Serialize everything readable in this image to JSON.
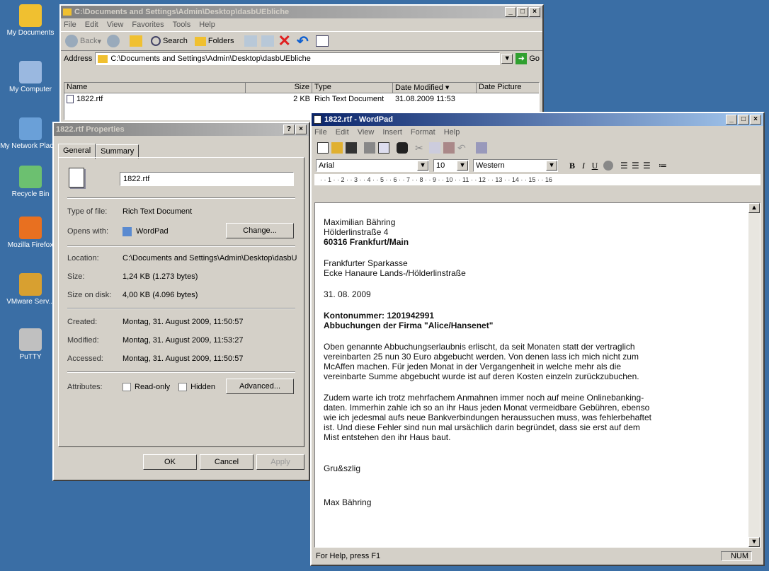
{
  "desktop": {
    "icons": [
      {
        "label": "My Documents",
        "icon": "folder-icon",
        "color": "#f0c030"
      },
      {
        "label": "My Computer",
        "icon": "computer-icon",
        "color": "#9ab8e0"
      },
      {
        "label": "My Network Places",
        "icon": "network-icon",
        "color": "#6aa0d8"
      },
      {
        "label": "Recycle Bin",
        "icon": "recycle-bin-icon",
        "color": "#6cc070"
      },
      {
        "label": "Mozilla Firefox",
        "icon": "firefox-icon",
        "color": "#e87020"
      },
      {
        "label": "VMware Serv...",
        "icon": "vmware-icon",
        "color": "#d8a030"
      },
      {
        "label": "PuTTY",
        "icon": "putty-icon",
        "color": "#c0c0c0"
      }
    ]
  },
  "explorer": {
    "title": "C:\\Documents and Settings\\Admin\\Desktop\\dasbUEbliche",
    "menu": [
      "File",
      "Edit",
      "View",
      "Favorites",
      "Tools",
      "Help"
    ],
    "toolbar": {
      "back": "Back",
      "search": "Search",
      "folders": "Folders"
    },
    "address_label": "Address",
    "address": "C:\\Documents and Settings\\Admin\\Desktop\\dasbUEbliche",
    "go": "Go",
    "columns": [
      "Name",
      "Size",
      "Type",
      "Date Modified",
      "Date Picture"
    ],
    "files": [
      {
        "name": "1822.rtf",
        "size": "2 KB",
        "type": "Rich Text Document",
        "modified": "31.08.2009 11:53"
      }
    ]
  },
  "props": {
    "title": "1822.rtf Properties",
    "tabs": [
      "General",
      "Summary"
    ],
    "filename": "1822.rtf",
    "rows": [
      {
        "k": "Type of file:",
        "v": "Rich Text Document"
      },
      {
        "k": "Opens with:",
        "v": "WordPad"
      },
      {
        "k": "Location:",
        "v": "C:\\Documents and Settings\\Admin\\Desktop\\dasbU"
      },
      {
        "k": "Size:",
        "v": "1,24 KB (1.273 bytes)"
      },
      {
        "k": "Size on disk:",
        "v": "4,00 KB (4.096 bytes)"
      },
      {
        "k": "Created:",
        "v": "Montag, 31. August 2009, 11:50:57"
      },
      {
        "k": "Modified:",
        "v": "Montag, 31. August 2009, 11:53:27"
      },
      {
        "k": "Accessed:",
        "v": "Montag, 31. August 2009, 11:50:57"
      }
    ],
    "change": "Change...",
    "attributes": "Attributes:",
    "readonly": "Read-only",
    "hidden": "Hidden",
    "advanced": "Advanced...",
    "ok": "OK",
    "cancel": "Cancel",
    "apply": "Apply"
  },
  "wordpad": {
    "title": "1822.rtf - WordPad",
    "menu": [
      "File",
      "Edit",
      "View",
      "Insert",
      "Format",
      "Help"
    ],
    "font": "Arial",
    "size": "10",
    "script": "Western",
    "ruler": "· · 1 · · 2 · · 3 · · 4 · · 5 · · 6 · · 7 · · 8 · · 9 · · 10 · · 11 · · 12 · · 13 · · 14 · · 15 · · 16",
    "doc": {
      "l1": "Maximilian Bähring",
      "l2": "Hölderlinstraße 4",
      "l3": "60316 Frankfurt/Main",
      "l4": "Frankfurter Sparkasse",
      "l5": "Ecke Hanaure Lands-/Hölderlinstraße",
      "date": "31. 08. 2009",
      "konto_label": "Kontonummer: ",
      "konto": "1201942991",
      "subject": "Abbuchungen der Firma \"Alice/Hansenet\"",
      "p1": [
        "Oben genannte Abbuchungserlaubnis erlischt, da seit Monaten statt der vertraglich",
        "vereinbarten 25 nun 30 Euro abgebucht werden. Von denen lass ich mich nicht zum",
        "McAffen machen. Für jeden Monat in der Vergangenheit in welche mehr als die",
        "vereinbarte Summe abgebucht wurde ist auf deren Kosten einzeln zurückzubuchen."
      ],
      "p2": [
        "Zudem warte ich trotz mehrfachem Anmahnen immer noch auf meine Onlinebanking-",
        "daten. Immerhin zahle ich so an ihr Haus jeden Monat vermeidbare Gebühren, ebenso",
        "wie ich jedesmal aufs neue Bankverbindungen heraussuchen muss, was fehlerbehaftet",
        "ist. Und diese Fehler sind nun mal ursächlich darin begründet, dass sie erst auf dem",
        "Mist entstehen den ihr Haus baut."
      ],
      "greet": "Gru&szlig",
      "sign": "Max Bähring"
    },
    "status": "For Help, press F1",
    "num": "NUM"
  }
}
